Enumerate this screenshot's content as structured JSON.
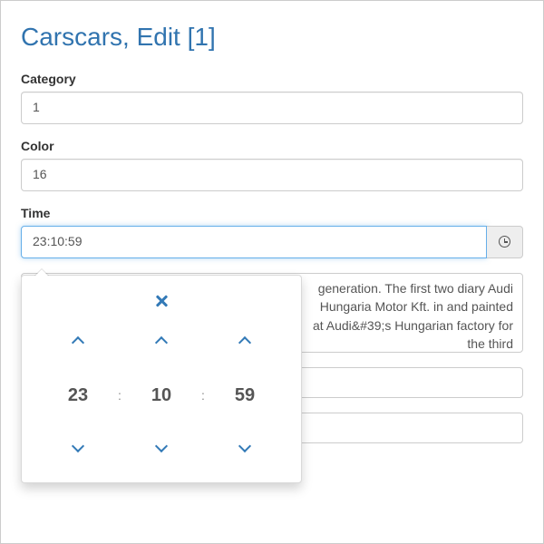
{
  "title": "Carscars, Edit [1]",
  "fields": {
    "category": {
      "label": "Category",
      "value": "1"
    },
    "color": {
      "label": "Color",
      "value": "16"
    },
    "time": {
      "label": "Time",
      "value": "23:10:59"
    },
    "description_visible_text": "generation. The first two diary Audi Hungaria Motor Kft. in and painted at Audi&#39;s Hungarian factory for the third"
  },
  "time_picker": {
    "hours": "23",
    "minutes": "10",
    "seconds": "59",
    "separator": ":"
  }
}
